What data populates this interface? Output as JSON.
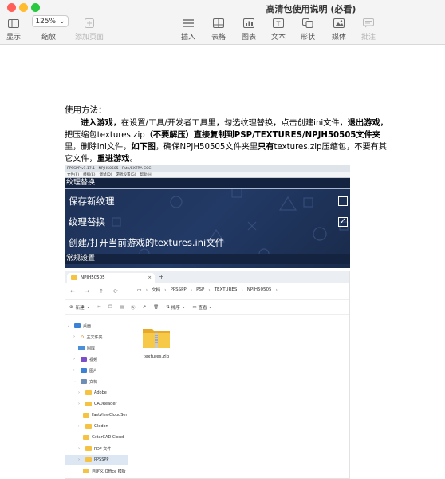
{
  "app": {
    "doc_title": "高清包使用说明 (必看)",
    "toolbar": {
      "view_label": "显示",
      "zoom_value": "125%",
      "zoom_label": "缩放",
      "add_page_label": "添加页面",
      "insert_label": "插入",
      "table_label": "表格",
      "chart_label": "图表",
      "text_label": "文本",
      "shape_label": "形状",
      "media_label": "媒体",
      "comment_label": "批注"
    }
  },
  "document": {
    "heading": "使用方法：",
    "para": {
      "p1": "进入游戏",
      "p2": "，在设置/工具/开发者工具里，勾选纹理替换，点击创建ini文件，",
      "p3": "退出游戏",
      "p4": "，把压缩包textures.zip",
      "p5": "（不要解压）直接复制到PSP/TEXTURES/NPJH50505文件夹",
      "p6": "里，删除ini文件，",
      "p7": "如下图",
      "p8": "，确保NPJH50505文件夹里",
      "p9": "只有",
      "p10": "textures.zip压缩包，不要有其它文件，",
      "p11": "重进游戏",
      "p12": "。"
    }
  },
  "ppsspp": {
    "window_title": "PPSSPP v1.17.1 - NPJH50505 : Fate/EXTRA CCC",
    "menu": [
      "文件(F)",
      "模拟(E)",
      "调试(D)",
      "游戏设置(G)",
      "帮助(H)"
    ],
    "section1": "纹理替换",
    "row_save_new": "保存新纹理",
    "row_replace": "纹理替换",
    "row_create_ini": "创建/打开当前游戏的textures.ini文件",
    "section2": "常规设置",
    "replace_checked_glyph": "✓"
  },
  "explorer": {
    "tab_title": "NPJH50505",
    "breadcrumbs": [
      "文档",
      "PPSSPP",
      "PSP",
      "TEXTURES",
      "NPJH50505"
    ],
    "cmd_new": "新建",
    "cmd_sort": "排序",
    "cmd_view": "查看",
    "cmd_more": "···",
    "sidebar": [
      {
        "label": "桌面"
      },
      {
        "label": "主文件夹"
      },
      {
        "label": "图库"
      },
      {
        "label": "视频"
      },
      {
        "label": "图片"
      },
      {
        "label": "文档"
      },
      {
        "label": "Adobe"
      },
      {
        "label": "CADReader"
      },
      {
        "label": "FastViewCloudSer"
      },
      {
        "label": "Glodon"
      },
      {
        "label": "GstarCAD Cloud"
      },
      {
        "label": "PDF 文件"
      },
      {
        "label": "PPSSPP"
      },
      {
        "label": "自定义 Office 模板"
      }
    ],
    "file_name": "textures.zip"
  }
}
